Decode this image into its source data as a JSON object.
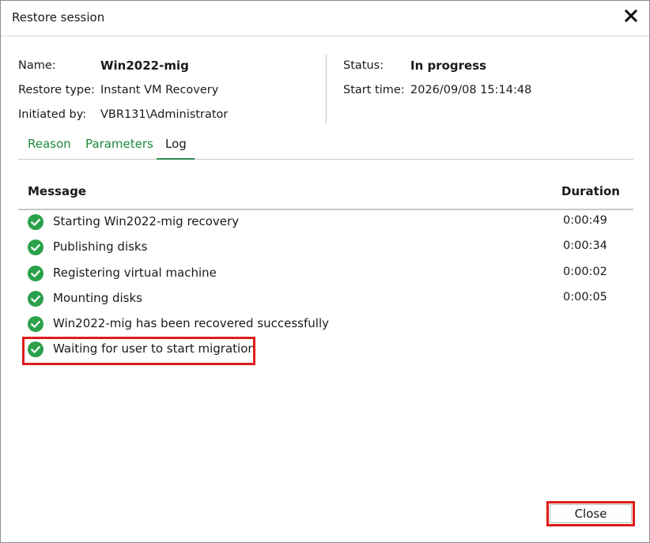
{
  "window": {
    "title": "Restore session"
  },
  "summary": {
    "name_label": "Name:",
    "name_value": "Win2022-mig",
    "restore_type_label": "Restore type:",
    "restore_type_value": "Instant VM Recovery",
    "initiated_by_label": "Initiated by:",
    "initiated_by_value": "VBR131\\Administrator",
    "status_label": "Status:",
    "status_value": "In progress",
    "start_time_label": "Start time:",
    "start_time_value": "2026/09/08 15:14:48"
  },
  "tabs": [
    {
      "label": "Reason",
      "active": false
    },
    {
      "label": "Parameters",
      "active": false
    },
    {
      "label": "Log",
      "active": true
    }
  ],
  "log": {
    "columns": [
      "Message",
      "Duration"
    ],
    "rows": [
      {
        "status": "success",
        "message": "Starting Win2022-mig recovery",
        "duration": "0:00:49"
      },
      {
        "status": "success",
        "message": "Publishing disks",
        "duration": "0:00:34"
      },
      {
        "status": "success",
        "message": "Registering virtual machine",
        "duration": "0:00:02"
      },
      {
        "status": "success",
        "message": "Mounting disks",
        "duration": "0:00:05"
      },
      {
        "status": "success",
        "message": "Win2022-mig has been recovered successfully",
        "duration": ""
      },
      {
        "status": "success",
        "message": "Waiting for user to start migration",
        "duration": ""
      }
    ]
  },
  "footer": {
    "close_label": "Close"
  },
  "colors": {
    "accent_green": "#1e8a3c",
    "success_icon": "#2ba14a",
    "highlight_red": "#e01b1b"
  },
  "icons": {
    "close": "close-x-icon",
    "row_status": "check-circle-icon"
  }
}
